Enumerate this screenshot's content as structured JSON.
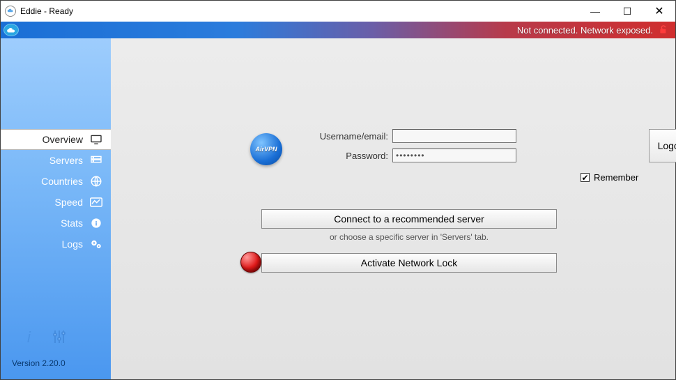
{
  "window": {
    "title": "Eddie - Ready"
  },
  "status": {
    "text": "Not connected. Network exposed."
  },
  "sidebar": {
    "items": [
      {
        "label": "Overview"
      },
      {
        "label": "Servers"
      },
      {
        "label": "Countries"
      },
      {
        "label": "Speed"
      },
      {
        "label": "Stats"
      },
      {
        "label": "Logs"
      }
    ],
    "version": "Version 2.20.0"
  },
  "login": {
    "username_label": "Username/email:",
    "password_label": "Password:",
    "username_value": "",
    "password_value": "********",
    "logout_label": "Logout",
    "remember_label": "Remember",
    "remember_checked": true
  },
  "actions": {
    "connect_label": "Connect to a recommended server",
    "hint": "or choose a specific server in 'Servers' tab.",
    "lock_label": "Activate Network Lock"
  },
  "logo_text": "AirVPN"
}
